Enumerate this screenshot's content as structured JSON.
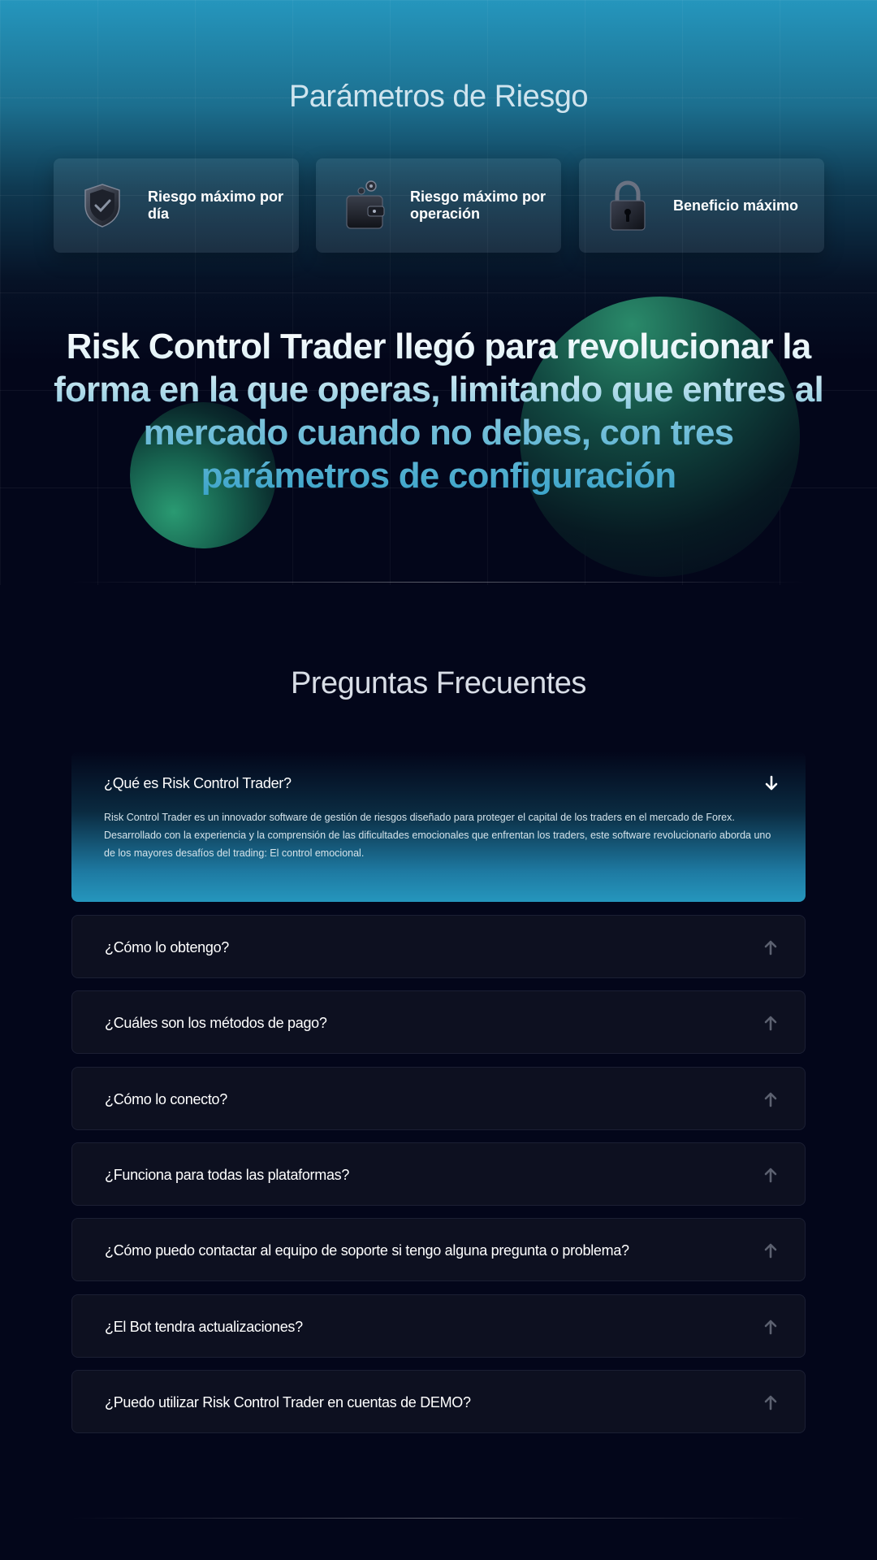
{
  "risk_section": {
    "title": "Parámetros de Riesgo",
    "cards": [
      {
        "label": "Riesgo máximo por día",
        "icon": "shield-icon"
      },
      {
        "label": "Riesgo máximo por operación",
        "icon": "wallet-icon"
      },
      {
        "label": "Beneficio máximo",
        "icon": "padlock-icon"
      }
    ]
  },
  "headline": "Risk Control Trader llegó para revolucionar la forma en la que operas, limitando que entres al mercado cuando no debes, con tres parámetros de configuración",
  "faq": {
    "title": "Preguntas Frecuentes",
    "items": [
      {
        "question": "¿Qué es Risk Control Trader?",
        "answer": "Risk Control Trader es un innovador software de gestión de riesgos diseñado para proteger el capital de los traders en el mercado de Forex. Desarrollado con la experiencia y la comprensión de las dificultades emocionales que enfrentan los traders, este software revolucionario aborda uno de los mayores desafíos del trading: El control emocional.",
        "expanded": true
      },
      {
        "question": "¿Cómo lo obtengo?",
        "expanded": false
      },
      {
        "question": "¿Cuáles son los métodos de pago?",
        "expanded": false
      },
      {
        "question": "¿Cómo lo conecto?",
        "expanded": false
      },
      {
        "question": "¿Funciona para todas las plataformas?",
        "expanded": false
      },
      {
        "question": "¿Cómo puedo contactar al equipo de soporte si tengo alguna pregunta o problema?",
        "expanded": false
      },
      {
        "question": "¿El Bot tendra actualizaciones?",
        "expanded": false
      },
      {
        "question": "¿Puedo utilizar Risk Control Trader en cuentas de DEMO?",
        "expanded": false
      }
    ]
  },
  "colors": {
    "accent": "#2596bd",
    "background": "#03061a",
    "card": "#0d1020"
  }
}
